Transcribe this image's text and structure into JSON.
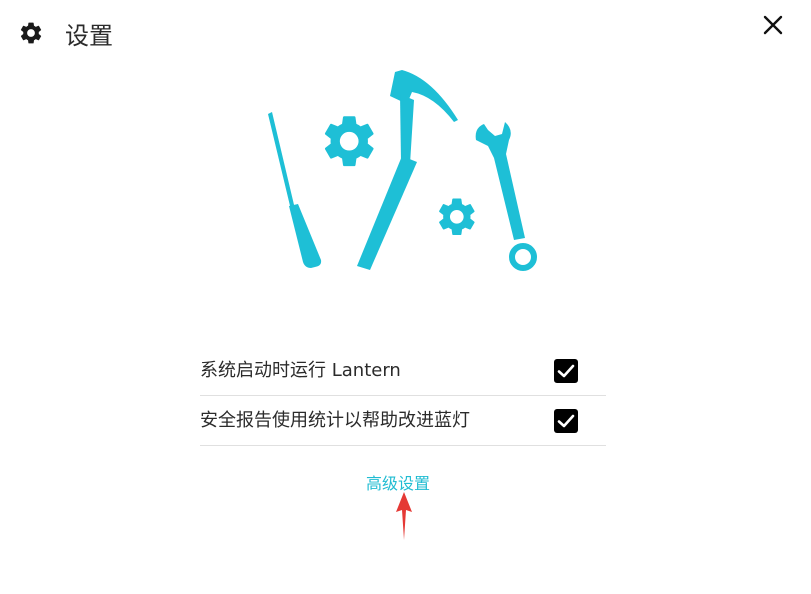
{
  "dialog": {
    "title": "设置",
    "title_icon": "gear-icon",
    "close_icon": "close-icon"
  },
  "illustration": {
    "icons": [
      "screwdriver-icon",
      "gear-icon",
      "hammer-icon",
      "gear-icon",
      "wrench-icon"
    ],
    "color": "#1ebfd6"
  },
  "options": [
    {
      "label": "系统启动时运行 Lantern",
      "checked": true
    },
    {
      "label": "安全报告使用统计以帮助改进蓝灯",
      "checked": true
    }
  ],
  "advanced": {
    "label": "高级设置",
    "color": "#20bcd2"
  },
  "annotation": {
    "arrow_color": "#e53935"
  }
}
